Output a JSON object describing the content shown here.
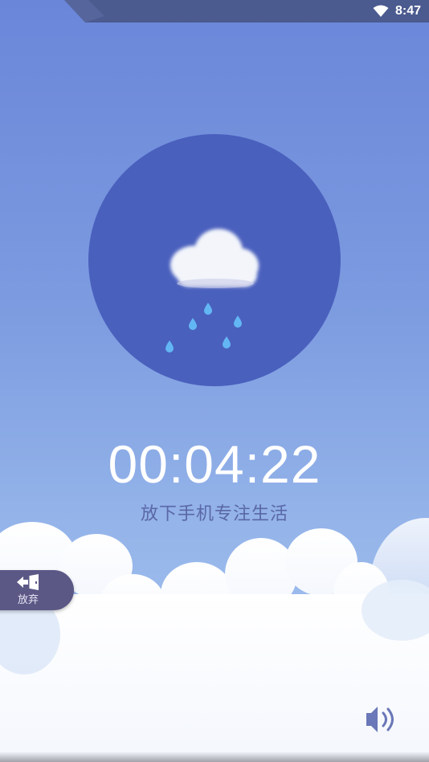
{
  "status_bar": {
    "time": "8:47",
    "wifi_icon": "wifi-icon"
  },
  "weather": {
    "icon": "cloud-rain-icon"
  },
  "timer": {
    "value": "00:04:22"
  },
  "slogan": "放下手机专注生活",
  "give_up": {
    "label": "放弃",
    "icon": "exit-door-icon"
  },
  "sound": {
    "icon": "speaker-icon"
  },
  "colors": {
    "sky_top": "#6a86d9",
    "sky_bottom": "#a9c7f0",
    "circle": "#4a60bd",
    "slogan": "#5a67a6",
    "give_up_bg": "#5b5886",
    "rain_drop": "#63b6f4"
  }
}
